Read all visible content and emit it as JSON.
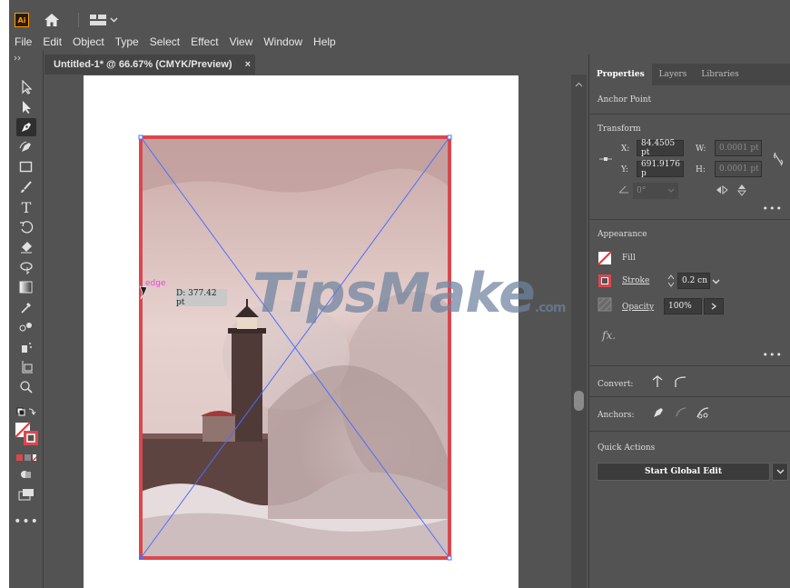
{
  "app": {
    "logo_text": "Ai"
  },
  "menu": [
    "File",
    "Edit",
    "Object",
    "Type",
    "Select",
    "Effect",
    "View",
    "Window",
    "Help"
  ],
  "document": {
    "tab_title": "Untitled-1* @ 66.67% (CMYK/Preview)",
    "tab_close": "×"
  },
  "canvas": {
    "measure_tooltip": "D: 377.42 pt",
    "smart_guide": "edge",
    "watermark": "TipsMake",
    "watermark_suffix": ".com"
  },
  "panel": {
    "tabs": [
      "Properties",
      "Layers",
      "Libraries"
    ],
    "selection_label": "Anchor Point",
    "transform": {
      "title": "Transform",
      "x_label": "X:",
      "x_value": "84.4505 pt",
      "y_label": "Y:",
      "y_value": "691.9176 p",
      "w_label": "W:",
      "w_value": "0.0001 pt",
      "h_label": "H:",
      "h_value": "0.0001 pt",
      "angle_value": "0°"
    },
    "appearance": {
      "title": "Appearance",
      "fill_label": "Fill",
      "stroke_label": "Stroke",
      "stroke_value": "0.2 cn",
      "opacity_label": "Opacity",
      "opacity_value": "100%",
      "fx_label": "fx."
    },
    "convert_label": "Convert:",
    "anchors_label": "Anchors:",
    "quick_actions": {
      "title": "Quick Actions",
      "button": "Start Global Edit"
    }
  },
  "colors": {
    "accent_stroke": "#d9484f",
    "guide": "#4f6cff"
  }
}
